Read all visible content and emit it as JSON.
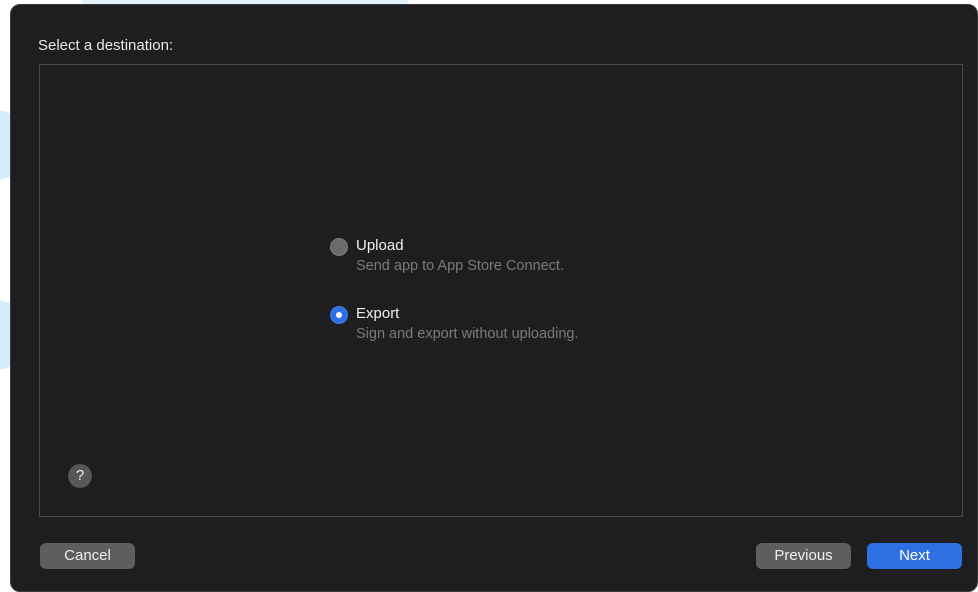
{
  "dialog": {
    "heading": "Select a destination:",
    "options": [
      {
        "title": "Upload",
        "description": "Send app to App Store Connect.",
        "selected": false
      },
      {
        "title": "Export",
        "description": "Sign and export without uploading.",
        "selected": true
      }
    ],
    "help_label": "?",
    "buttons": {
      "cancel": "Cancel",
      "previous": "Previous",
      "next": "Next"
    }
  },
  "colors": {
    "dialog_background": "#1e1e21",
    "accent": "#2f6fe4",
    "secondary_button": "#5e5e61",
    "muted_text": "#7a7a7d"
  }
}
